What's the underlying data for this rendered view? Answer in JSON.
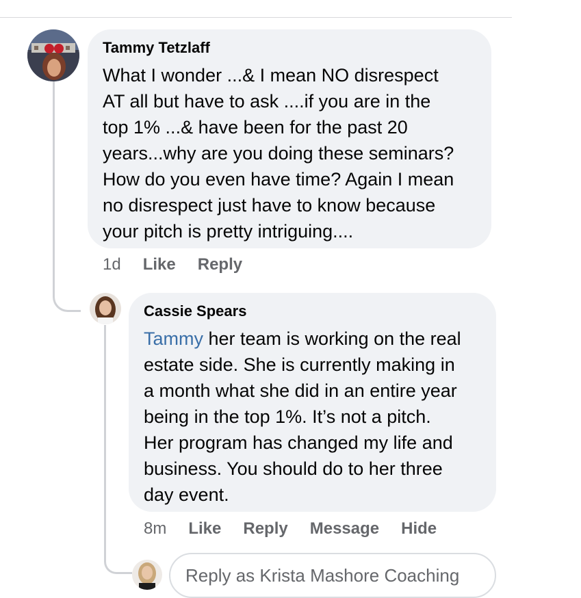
{
  "comments": [
    {
      "author": "Tammy Tetzlaff",
      "text_lines": [
        "What I wonder ...& I mean NO disrespect",
        "AT all but have to ask ....if you are in the",
        "top 1% ...& have been for the past 20",
        "years...why are you doing these seminars?",
        "How do you even have time?  Again I mean",
        "no disrespect just have to know because",
        "your pitch is pretty intriguing...."
      ],
      "time": "1d",
      "actions": [
        "Like",
        "Reply"
      ]
    }
  ],
  "reply": {
    "author": "Cassie Spears",
    "mention": "Tammy",
    "first_line_rest": " her team is working on the real",
    "text_lines": [
      "estate side. She is currently making in",
      "a month what she did in an entire year",
      "being in the top 1%. It’s not a pitch.",
      "Her program has changed my life and",
      "business. You should do to her three",
      "day event."
    ],
    "time": "8m",
    "actions": [
      "Like",
      "Reply",
      "Message",
      "Hide"
    ]
  },
  "composer": {
    "placeholder": "Reply as Krista Mashore Coaching"
  },
  "colors": {
    "bubble": "#f0f2f5",
    "mention": "#3a6fa8",
    "secondary_text": "#65676b",
    "thread_line": "#d0d2d6"
  }
}
